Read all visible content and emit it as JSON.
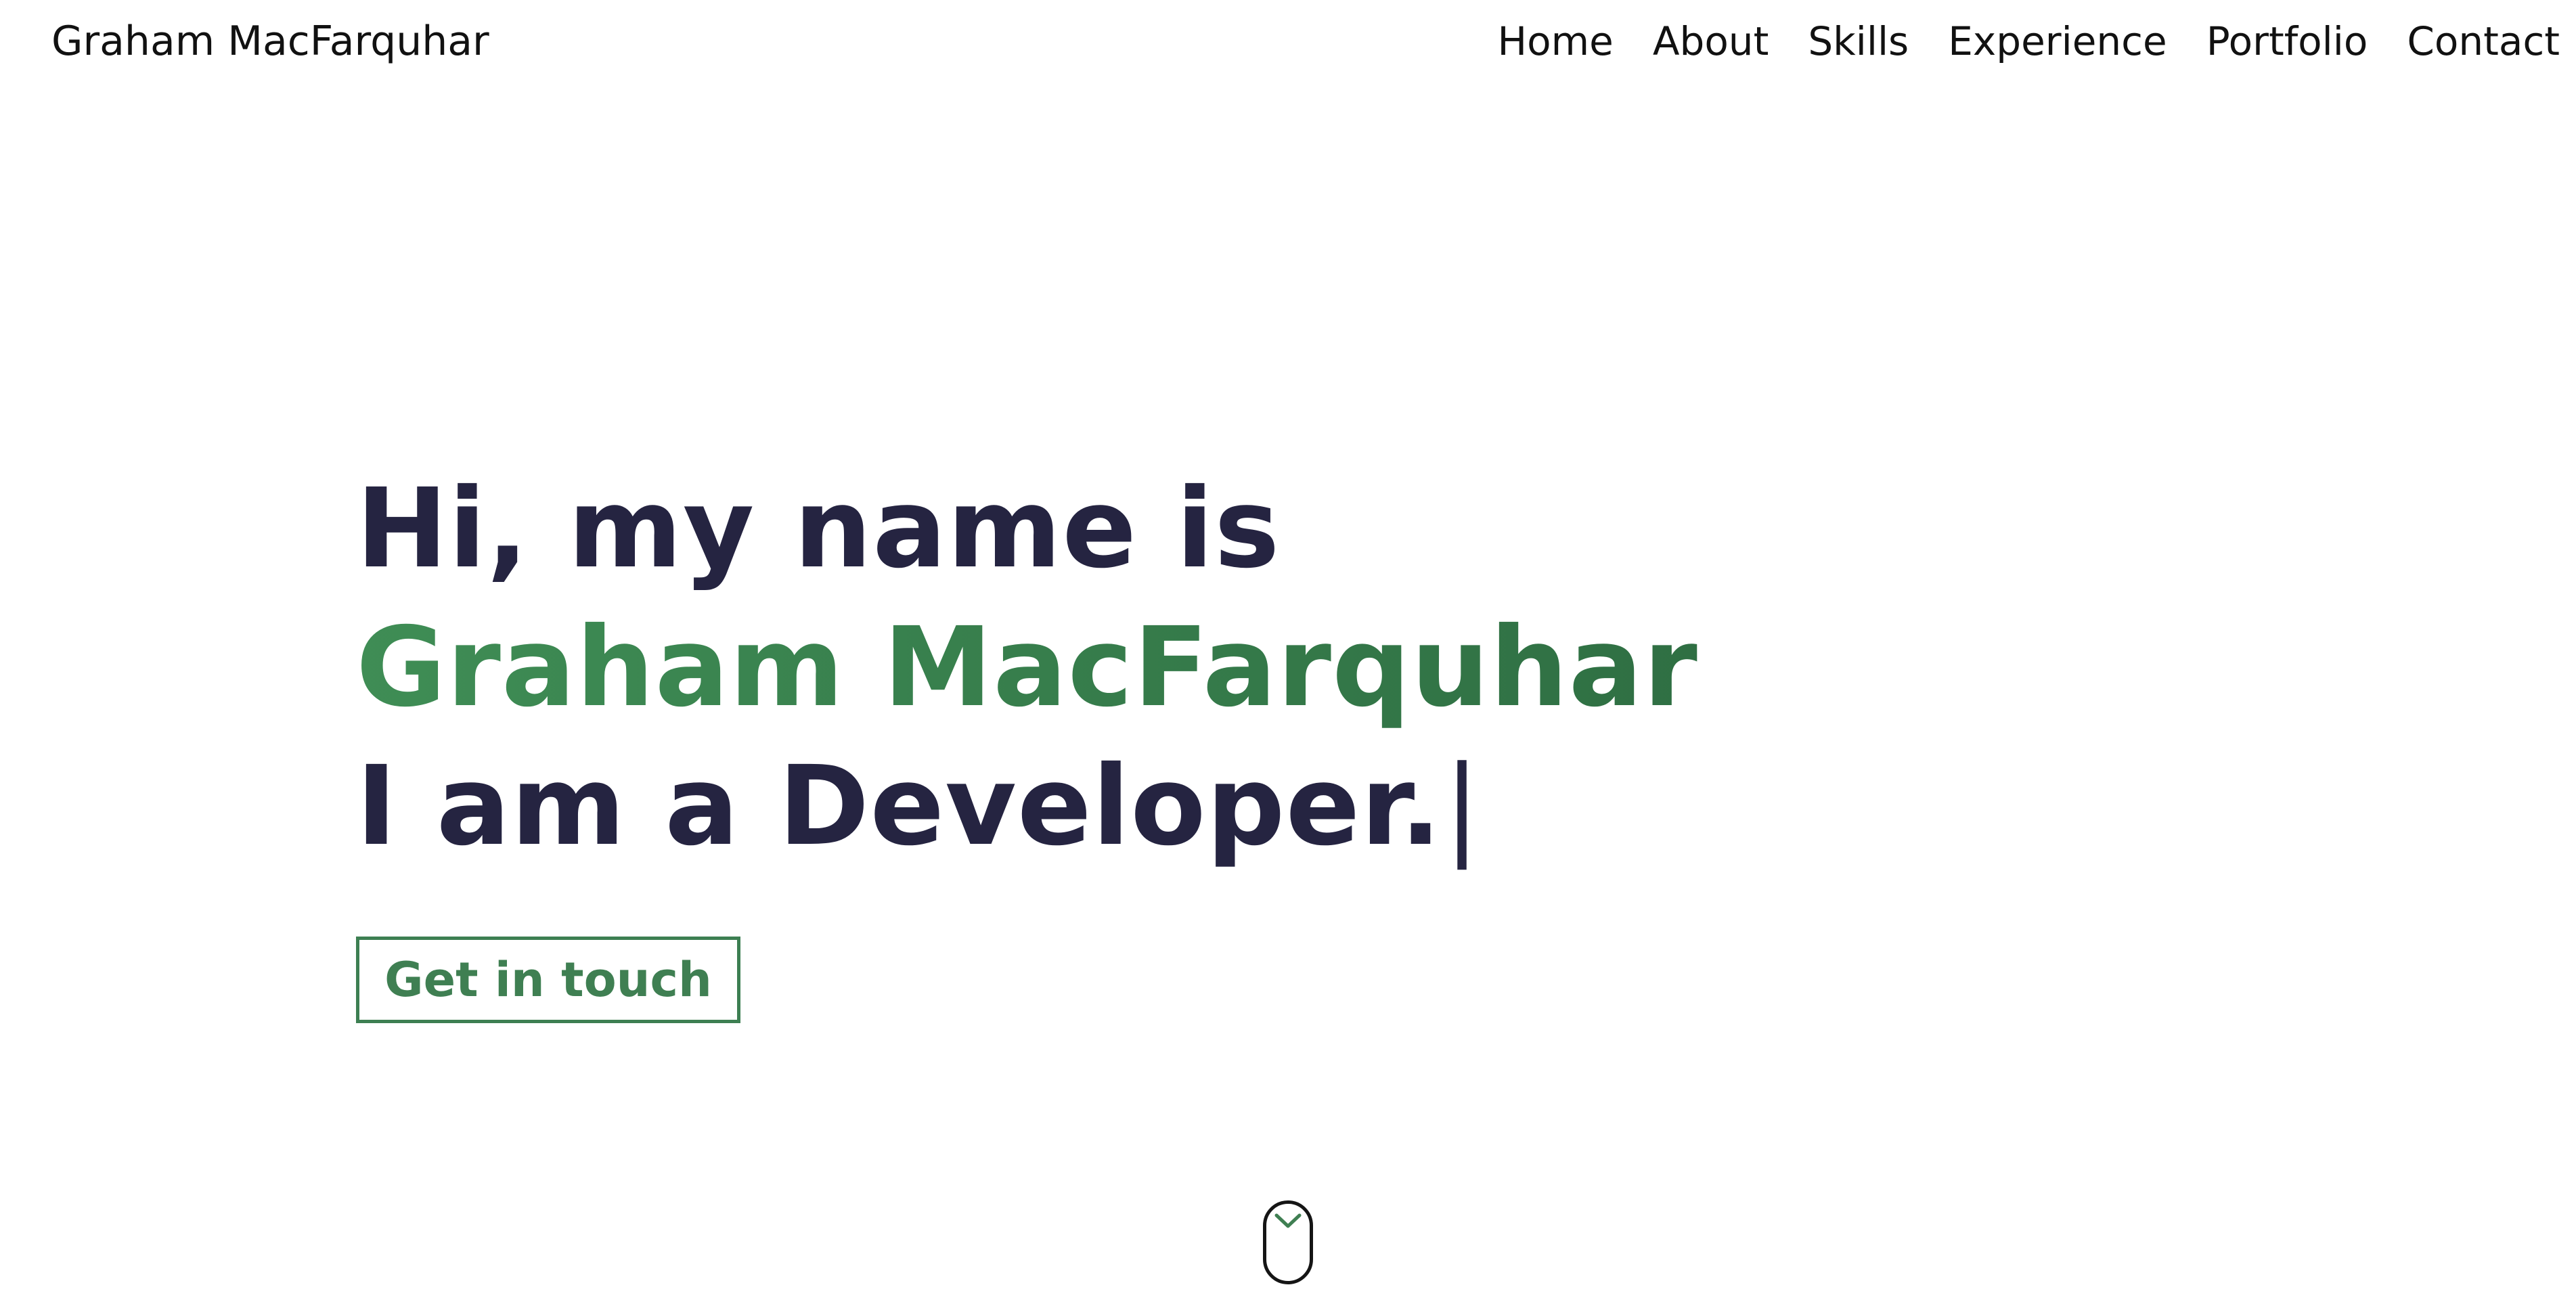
{
  "header": {
    "brand": "Graham MacFarquhar",
    "nav": [
      {
        "label": "Home"
      },
      {
        "label": "About"
      },
      {
        "label": "Skills"
      },
      {
        "label": "Experience"
      },
      {
        "label": "Portfolio"
      },
      {
        "label": "Contact"
      }
    ]
  },
  "hero": {
    "line1": "Hi, my name is",
    "line2": "Graham MacFarquhar",
    "line3": "I am a Developer.",
    "cursor": "|",
    "cta_label": "Get in touch"
  },
  "scroll": {
    "icon": "chevron-down-icon"
  },
  "colors": {
    "text_dark": "#252441",
    "accent_green": "#3f8d55",
    "button_green": "#3d7f52",
    "background": "#ffffff"
  }
}
